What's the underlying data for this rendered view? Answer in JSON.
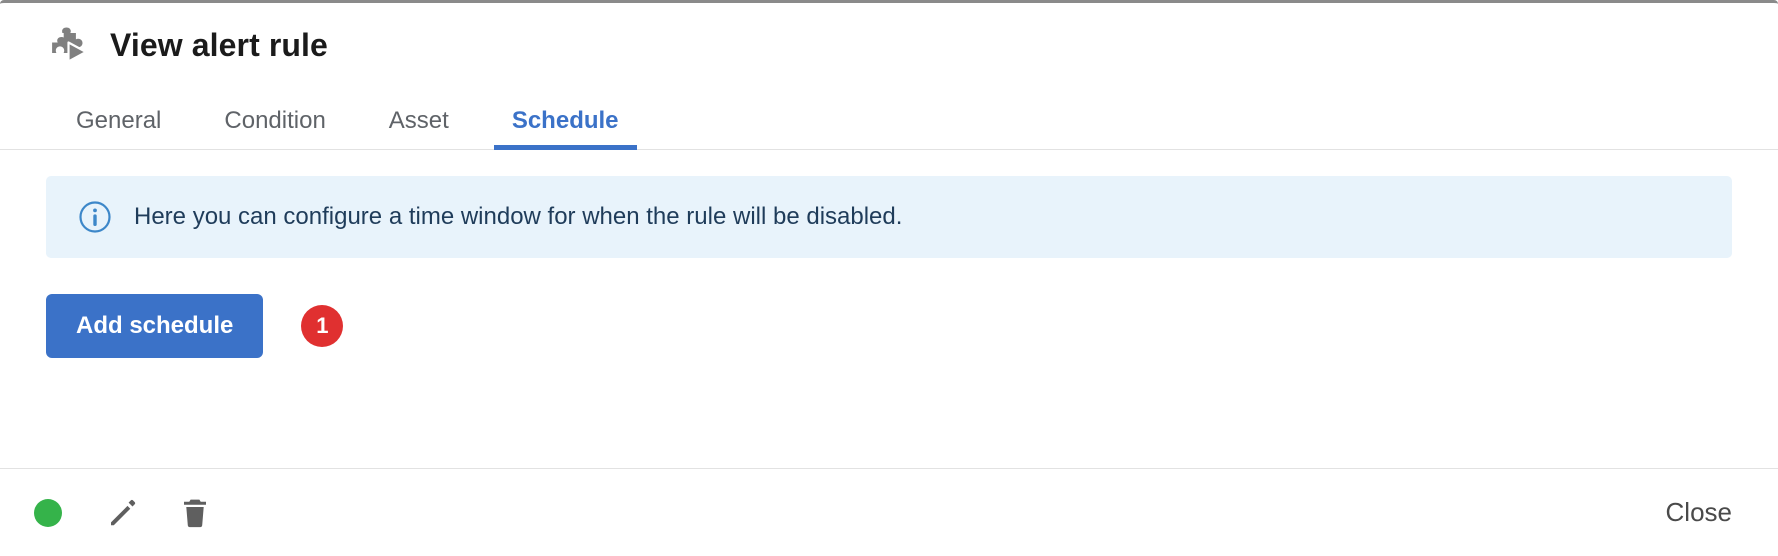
{
  "dialog": {
    "title": "View alert rule",
    "title_icon": "puzzle-play-icon"
  },
  "tabs": [
    {
      "label": "General",
      "active": false
    },
    {
      "label": "Condition",
      "active": false
    },
    {
      "label": "Asset",
      "active": false
    },
    {
      "label": "Schedule",
      "active": true
    }
  ],
  "info_banner": {
    "icon": "info-circle-icon",
    "text": "Here you can configure a time window for when the rule will be disabled."
  },
  "actions": {
    "add_schedule_label": "Add schedule",
    "badge_count": "1"
  },
  "footer": {
    "status_dot": "status-dot-green",
    "edit_icon": "pencil-icon",
    "delete_icon": "trash-icon",
    "close_label": "Close"
  },
  "colors": {
    "accent_blue": "#3b72c8",
    "banner_bg": "#e8f3fb",
    "banner_text": "#1f3c5a",
    "badge_red": "#e03030",
    "status_green": "#35b34a",
    "tab_inactive": "#5f6368",
    "title_text": "#1b1b1b"
  }
}
